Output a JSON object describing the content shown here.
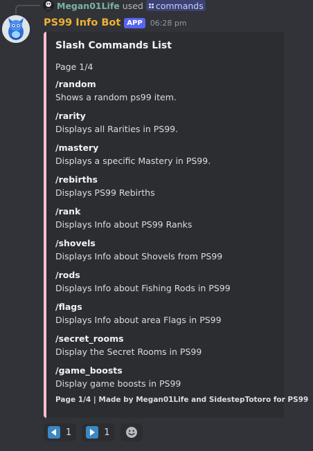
{
  "used_line": {
    "user": "Megan01Life",
    "verb": "used",
    "command": "commands",
    "user_color": "#7ab4a0"
  },
  "message": {
    "bot_name": "PS99 Info Bot",
    "badge": "APP",
    "timestamp": "06:28 pm",
    "bot_name_color": "#f0b232",
    "badge_color": "#5865f2"
  },
  "embed": {
    "accent_color": "#f5c1c9",
    "title": "Slash Commands List",
    "page": "Page 1/4",
    "fields": [
      {
        "name": "/random",
        "value": "Shows a random ps99 item."
      },
      {
        "name": "/rarity",
        "value": "Displays all Rarities in PS99."
      },
      {
        "name": "/mastery",
        "value": "Displays a specific Mastery in PS99."
      },
      {
        "name": "/rebirths",
        "value": "Displays PS99 Rebirths"
      },
      {
        "name": "/rank",
        "value": "Displays Info about PS99 Ranks"
      },
      {
        "name": "/shovels",
        "value": "Displays Info about Shovels from PS99"
      },
      {
        "name": "/rods",
        "value": "Displays Info about Fishing Rods in PS99"
      },
      {
        "name": "/flags",
        "value": "Displays Info about area Flags in PS99"
      },
      {
        "name": "/secret_rooms",
        "value": "Display the Secret Rooms in PS99"
      },
      {
        "name": "/game_boosts",
        "value": "Display game boosts in PS99"
      }
    ],
    "footer": "Page 1/4 | Made by Megan01Life and SidestepTotoro for PS99"
  },
  "reactions": [
    {
      "icon": "left-arrow-icon",
      "count": "1"
    },
    {
      "icon": "right-arrow-icon",
      "count": "1"
    },
    {
      "icon": "add-reaction-icon"
    }
  ]
}
